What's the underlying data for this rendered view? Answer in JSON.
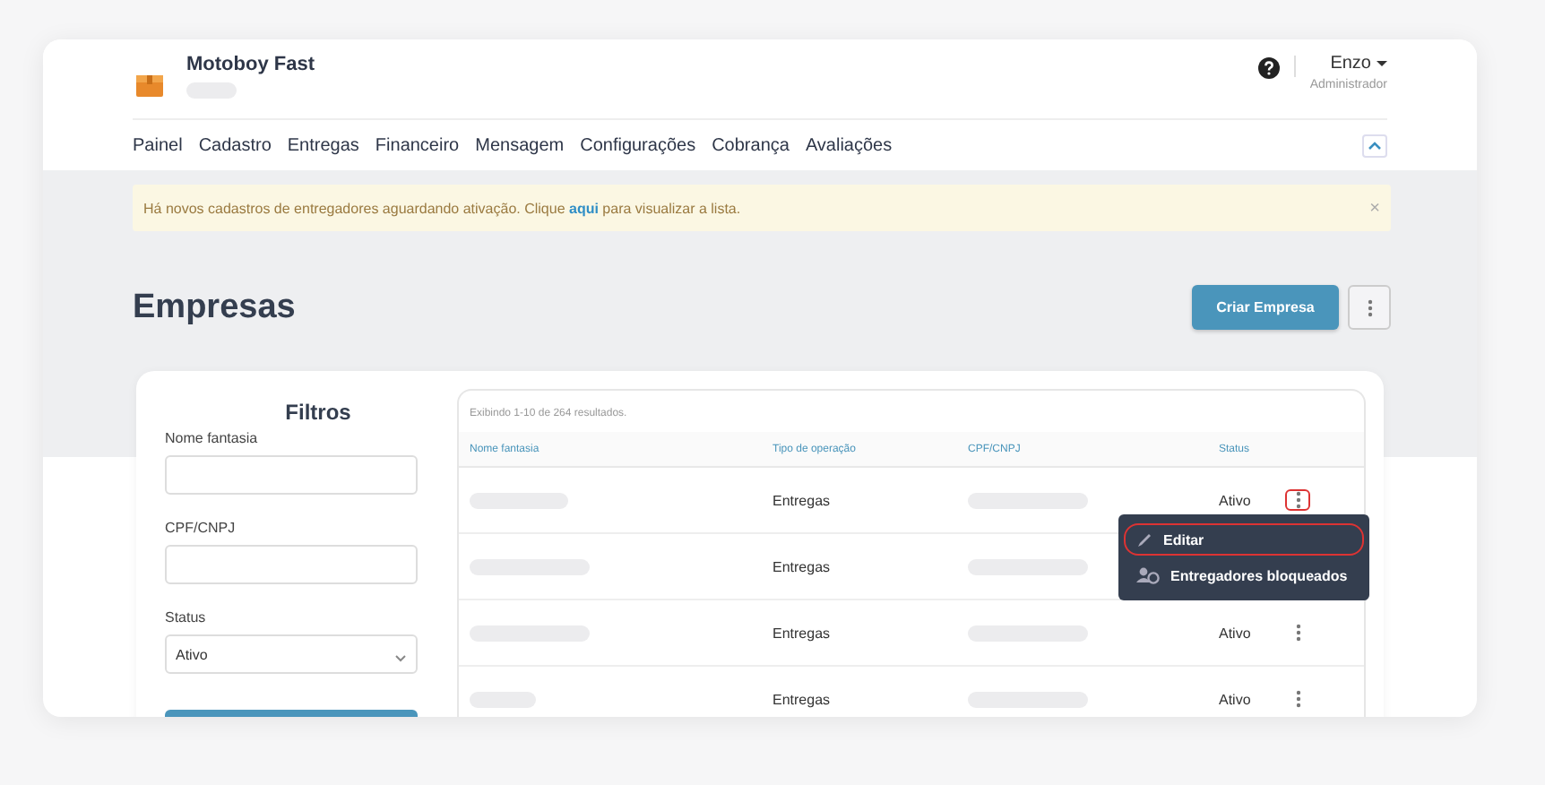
{
  "app": {
    "title": "Motoboy Fast"
  },
  "user": {
    "name": "Enzo",
    "role": "Administrador"
  },
  "nav": [
    {
      "label": "Painel"
    },
    {
      "label": "Cadastro"
    },
    {
      "label": "Entregas"
    },
    {
      "label": "Financeiro"
    },
    {
      "label": "Mensagem"
    },
    {
      "label": "Configurações"
    },
    {
      "label": "Cobrança"
    },
    {
      "label": "Avaliações"
    }
  ],
  "alert": {
    "text": "Há novos cadastros de entregadores aguardando ativação. Clique ",
    "link": "aqui",
    "after": " para visualizar a lista.",
    "close": "×"
  },
  "page": {
    "title": "Empresas",
    "primary_button": "Criar Empresa"
  },
  "filters": {
    "title": "Filtros",
    "fields": [
      {
        "kind": "text",
        "label": "Nome fantasia"
      },
      {
        "kind": "text",
        "label": "CPF/CNPJ"
      },
      {
        "kind": "select",
        "label": "Status",
        "value": "Ativo"
      }
    ]
  },
  "table": {
    "summary": "Exibindo 1-10 de 264 resultados.",
    "columns": [
      "Nome fantasia",
      "Tipo de operação",
      "CPF/CNPJ",
      "Status"
    ],
    "rows": [
      {
        "type": "Entregas",
        "status": "Ativo",
        "actions_visible": true,
        "menu_open": true
      },
      {
        "type": "Entregas",
        "actions_visible": false,
        "menu_open": false
      },
      {
        "type": "Entregas",
        "status": "Ativo",
        "actions_visible": true,
        "menu_open": false
      },
      {
        "type": "Entregas",
        "status": "Ativo",
        "actions_visible": true,
        "menu_open": false
      }
    ]
  },
  "row_menu": {
    "items": [
      {
        "label": "Editar",
        "kind": "edit",
        "selected": true
      },
      {
        "label": "Entregadores bloqueados",
        "kind": "blocked",
        "selected": false
      }
    ]
  }
}
